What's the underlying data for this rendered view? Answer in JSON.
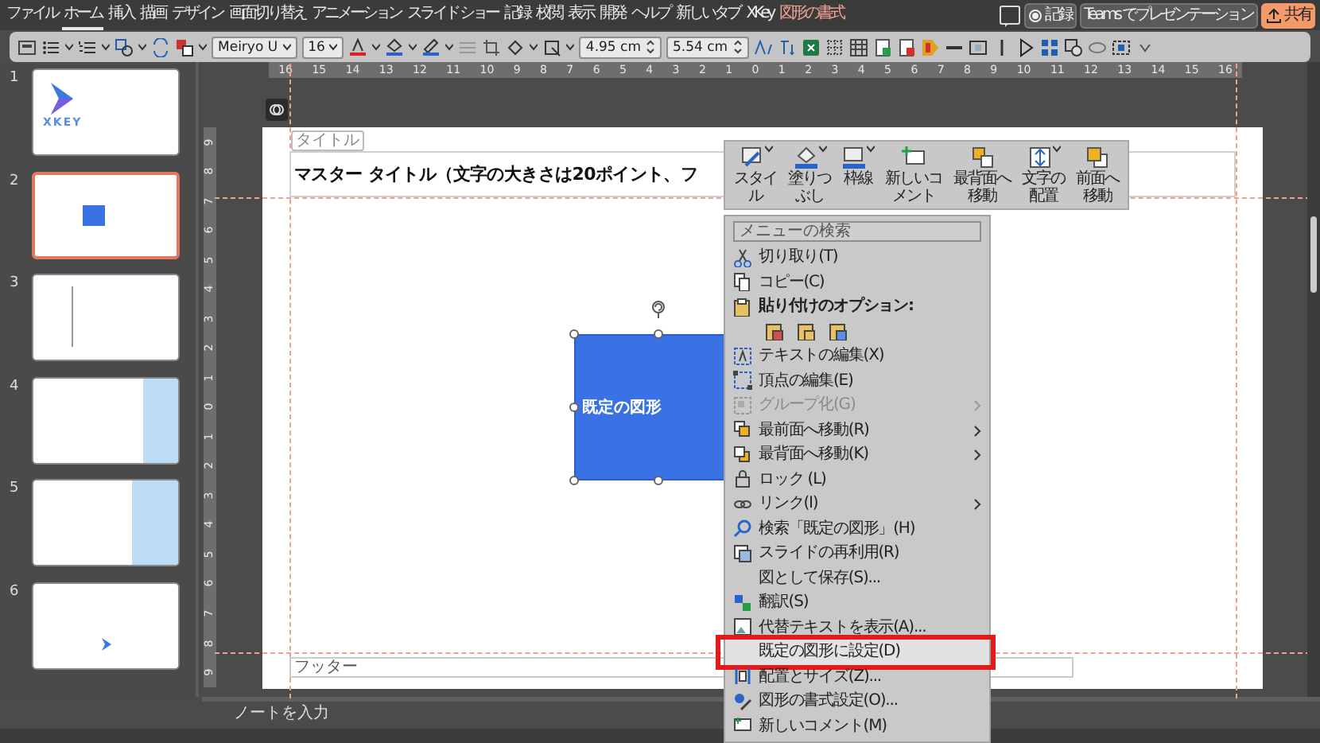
{
  "ribbon_tabs": [
    {
      "label": "ファイル",
      "selected": false,
      "contextual": false
    },
    {
      "label": "ホーム",
      "selected": true,
      "contextual": false
    },
    {
      "label": "挿入",
      "selected": false,
      "contextual": false
    },
    {
      "label": "描画",
      "selected": false,
      "contextual": false
    },
    {
      "label": "デザイン",
      "selected": false,
      "contextual": false
    },
    {
      "label": "画面切り替え",
      "selected": false,
      "contextual": false
    },
    {
      "label": "アニメーション",
      "selected": false,
      "contextual": false
    },
    {
      "label": "スライド ショー",
      "selected": false,
      "contextual": false
    },
    {
      "label": "記録",
      "selected": false,
      "contextual": false
    },
    {
      "label": "校閲",
      "selected": false,
      "contextual": false
    },
    {
      "label": "表示",
      "selected": false,
      "contextual": false
    },
    {
      "label": "開発",
      "selected": false,
      "contextual": false
    },
    {
      "label": "ヘルプ",
      "selected": false,
      "contextual": false
    },
    {
      "label": "新しいタブ",
      "selected": false,
      "contextual": false
    },
    {
      "label": "XKey",
      "selected": false,
      "contextual": false
    },
    {
      "label": "図形の書式",
      "selected": false,
      "contextual": true
    }
  ],
  "title_bar_buttons": {
    "record": "記録",
    "present": "Teams でプレゼンテーション",
    "share": "共有"
  },
  "toolbar": {
    "font": "Meiryo U",
    "font_size": "16",
    "shape_height": "4.95 cm",
    "shape_width": "5.54 cm"
  },
  "horizontal_ruler": [
    "16",
    "15",
    "14",
    "13",
    "12",
    "11",
    "10",
    "9",
    "8",
    "7",
    "6",
    "5",
    "4",
    "3",
    "2",
    "1",
    "0",
    "1",
    "2",
    "3",
    "4",
    "5",
    "6",
    "7",
    "8",
    "9",
    "10",
    "11",
    "12",
    "13",
    "14",
    "15",
    "16"
  ],
  "vertical_ruler": [
    "9",
    "8",
    "7",
    "6",
    "5",
    "4",
    "3",
    "2",
    "1",
    "0",
    "1",
    "2",
    "3",
    "4",
    "5",
    "6",
    "7",
    "8",
    "9"
  ],
  "slides": [
    {
      "number": "1",
      "selected": false,
      "kind": "logo_title",
      "logo_text": "XKEY"
    },
    {
      "number": "2",
      "selected": true,
      "kind": "shape"
    },
    {
      "number": "3",
      "selected": false,
      "kind": "divider"
    },
    {
      "number": "4",
      "selected": false,
      "kind": "panel_narrow"
    },
    {
      "number": "5",
      "selected": false,
      "kind": "panel_wide"
    },
    {
      "number": "6",
      "selected": false,
      "kind": "small_logo"
    }
  ],
  "slide": {
    "title_tag": "タイトル",
    "title": "マスター タイトル（文字の大きさは20ポイント、フ",
    "shape_text": "既定の図形",
    "footer": "フッター"
  },
  "mini_toolbar": [
    {
      "label": "スタイル",
      "dropdown": true
    },
    {
      "label": "塗りつぶし",
      "dropdown": true
    },
    {
      "label": "枠線",
      "dropdown": true
    },
    {
      "label": "新しいコメント",
      "dropdown": false
    },
    {
      "label": "最背面へ移動",
      "dropdown": false
    },
    {
      "label": "文字の配置",
      "dropdown": true
    },
    {
      "label": "前面へ移動",
      "dropdown": false
    }
  ],
  "context_menu": [
    {
      "kind": "search",
      "placeholder": "メニューの検索"
    },
    {
      "kind": "item",
      "label": "切り取り(T)",
      "disabled": false,
      "submenu": false,
      "selected": false,
      "annotated": false
    },
    {
      "kind": "item",
      "label": "コピー(C)",
      "disabled": false,
      "submenu": false,
      "selected": false,
      "annotated": false
    },
    {
      "kind": "heading",
      "label": "貼り付けのオプション:"
    },
    {
      "kind": "paste_options"
    },
    {
      "kind": "item",
      "label": "テキストの編集(X)",
      "disabled": false,
      "submenu": false,
      "selected": false,
      "annotated": false
    },
    {
      "kind": "item",
      "label": "頂点の編集(E)",
      "disabled": false,
      "submenu": false,
      "selected": false,
      "annotated": false
    },
    {
      "kind": "item",
      "label": "グループ化(G)",
      "disabled": true,
      "submenu": true,
      "selected": false,
      "annotated": false
    },
    {
      "kind": "item",
      "label": "最前面へ移動(R)",
      "disabled": false,
      "submenu": true,
      "selected": false,
      "annotated": false
    },
    {
      "kind": "item",
      "label": "最背面へ移動(K)",
      "disabled": false,
      "submenu": true,
      "selected": false,
      "annotated": false
    },
    {
      "kind": "item",
      "label": "ロック (L)",
      "disabled": false,
      "submenu": false,
      "selected": false,
      "annotated": false
    },
    {
      "kind": "item",
      "label": "リンク(I)",
      "disabled": false,
      "submenu": true,
      "selected": false,
      "annotated": false
    },
    {
      "kind": "item",
      "label": "検索「既定の図形」(H)",
      "disabled": false,
      "submenu": false,
      "selected": false,
      "annotated": false
    },
    {
      "kind": "item",
      "label": "スライドの再利用(R)",
      "disabled": false,
      "submenu": false,
      "selected": false,
      "annotated": false
    },
    {
      "kind": "item",
      "label": "図として保存(S)...",
      "disabled": false,
      "submenu": false,
      "selected": false,
      "annotated": false
    },
    {
      "kind": "item",
      "label": "翻訳(S)",
      "disabled": false,
      "submenu": false,
      "selected": false,
      "annotated": false
    },
    {
      "kind": "item",
      "label": "代替テキストを表示(A)...",
      "disabled": false,
      "submenu": false,
      "selected": false,
      "annotated": false
    },
    {
      "kind": "item",
      "label": "既定の図形に設定(D)",
      "disabled": false,
      "submenu": false,
      "selected": true,
      "annotated": true
    },
    {
      "kind": "item",
      "label": "配置とサイズ(Z)...",
      "disabled": false,
      "submenu": false,
      "selected": false,
      "annotated": false
    },
    {
      "kind": "item",
      "label": "図形の書式設定(O)...",
      "disabled": false,
      "submenu": false,
      "selected": false,
      "annotated": false
    },
    {
      "kind": "item",
      "label": "新しいコメント(M)",
      "disabled": false,
      "submenu": false,
      "selected": false,
      "annotated": false
    }
  ],
  "notes": {
    "placeholder": "ノートを入力"
  }
}
